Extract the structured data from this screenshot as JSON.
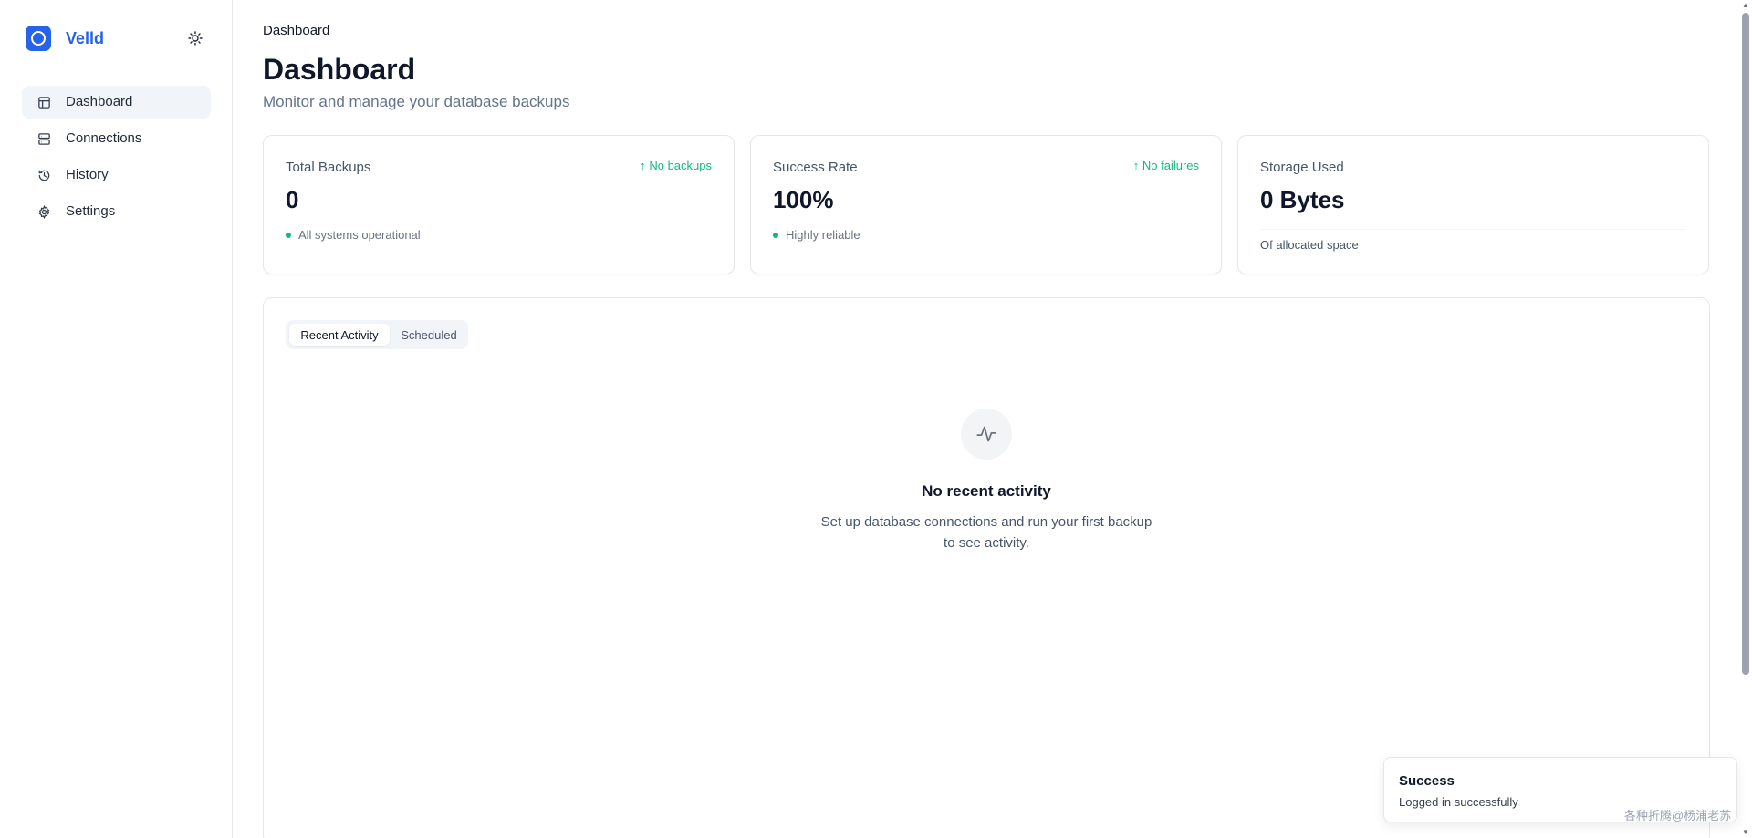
{
  "sidebar": {
    "brand_name": "Velld",
    "brand_logo_icon": "circle-logo-icon",
    "theme_toggle_icon": "sun-icon",
    "nav": [
      {
        "label": "Dashboard",
        "icon": "layout-icon",
        "active": true
      },
      {
        "label": "Connections",
        "icon": "server-icon",
        "active": false
      },
      {
        "label": "History",
        "icon": "history-icon",
        "active": false
      },
      {
        "label": "Settings",
        "icon": "gear-icon",
        "active": false
      }
    ]
  },
  "header": {
    "breadcrumb": "Dashboard",
    "title": "Dashboard",
    "subtitle": "Monitor and manage your database backups"
  },
  "stats": [
    {
      "label": "Total Backups",
      "value": "0",
      "trend": "No backups",
      "note": "All systems operational"
    },
    {
      "label": "Success Rate",
      "value": "100%",
      "trend": "No failures",
      "note": "Highly reliable"
    },
    {
      "label": "Storage Used",
      "value": "0 Bytes",
      "note": "Of allocated space"
    }
  ],
  "activity": {
    "tabs": [
      {
        "label": "Recent Activity",
        "active": true
      },
      {
        "label": "Scheduled",
        "active": false
      }
    ],
    "empty_icon": "activity-pulse-icon",
    "empty_title": "No recent activity",
    "empty_desc_line1": "Set up database connections and run your first backup",
    "empty_desc_line2": "to see activity."
  },
  "toast": {
    "title": "Success",
    "message": "Logged in successfully"
  },
  "watermark": "各种折腾@杨浦老苏",
  "colors": {
    "accent": "#2563eb",
    "success": "#10b981",
    "muted_text": "#64748b",
    "border": "#e5e7eb"
  }
}
